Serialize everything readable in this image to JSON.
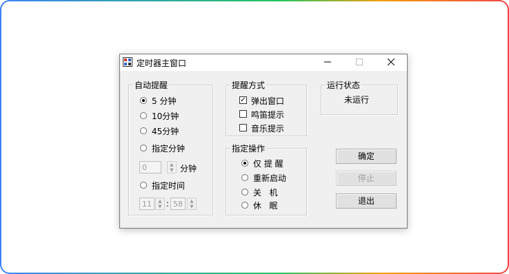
{
  "window": {
    "title": "定时器主窗口"
  },
  "auto_remind": {
    "title": "自动提醒",
    "options": [
      {
        "label": "5 分钟",
        "selected": true
      },
      {
        "label": "10分钟",
        "selected": false
      },
      {
        "label": "45分钟",
        "selected": false
      },
      {
        "label": "指定分钟",
        "selected": false
      },
      {
        "label": "指定时间",
        "selected": false
      }
    ],
    "minutes_value": "0",
    "minutes_unit": "分钟",
    "hour_value": "11",
    "time_sep": ":",
    "minute_value": "58"
  },
  "remind_method": {
    "title": "提醒方式",
    "options": [
      {
        "label": "弹出窗口",
        "checked": true
      },
      {
        "label": "鸣笛提示",
        "checked": false
      },
      {
        "label": "音乐提示",
        "checked": false
      }
    ]
  },
  "operation": {
    "title": "指定操作",
    "options": [
      {
        "label": "仅 提 醒",
        "selected": true
      },
      {
        "label": "重新启动",
        "selected": false
      },
      {
        "label": "关   机",
        "selected": false
      },
      {
        "label": "休   眠",
        "selected": false
      }
    ]
  },
  "status": {
    "title": "运行状态",
    "value": "未运行"
  },
  "buttons": {
    "ok": "确定",
    "stop": "停止",
    "exit": "退出"
  },
  "colors": {
    "disabled_text": "#a0a0a0",
    "window_bg": "#f0f0f0"
  }
}
